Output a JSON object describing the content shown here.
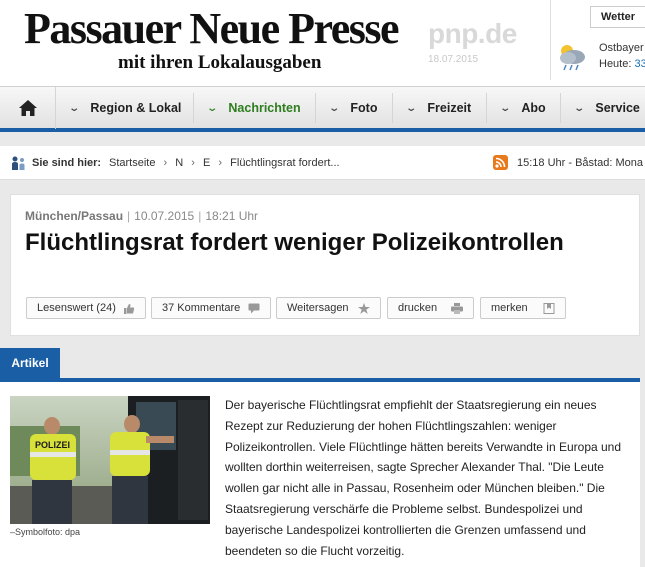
{
  "masthead": {
    "title": "Passauer Neue Presse",
    "subtitle": "mit ihren Lokalausgaben",
    "domain": "pnp.de",
    "date": "18.07.2015",
    "weather_tab": "Wetter",
    "weather_region": "Ostbayer",
    "weather_today_label": "Heute:",
    "weather_today_temp": "33",
    "weather_icon": "cloud-rain-icon"
  },
  "nav": {
    "home_icon": "home-icon",
    "items": [
      {
        "label": "Region & Lokal"
      },
      {
        "label": "Nachrichten"
      },
      {
        "label": "Foto"
      },
      {
        "label": "Freizeit"
      },
      {
        "label": "Abo"
      },
      {
        "label": "Service"
      }
    ],
    "active_color": "#2e7d1e",
    "accent": "#1a5fa6"
  },
  "breadcrumb": {
    "label": "Sie sind hier:",
    "items": [
      "Startseite",
      "N",
      "E",
      "Flüchtlingsrat fordert..."
    ],
    "separator": "›",
    "ticker": "15:18 Uhr - Båstad: Mona"
  },
  "article": {
    "section": "München/Passau",
    "date": "10.07.2015",
    "time": "18:21 Uhr",
    "headline": "Flüchtlingsrat fordert weniger Polizeikontrollen",
    "actions": [
      {
        "label": "Lesenswert (24)",
        "icon": "thumbs-up-icon"
      },
      {
        "label": "37 Kommentare",
        "icon": "speech-bubble-icon"
      },
      {
        "label": "Weitersagen",
        "icon": "star-icon"
      },
      {
        "label": "drucken",
        "icon": "printer-icon"
      },
      {
        "label": "merken",
        "icon": "bookmark-icon"
      }
    ],
    "tab": "Artikel",
    "photo_caption": "–Symbolfoto: dpa",
    "photo_vest_text": "POLIZEI",
    "body": "Der bayerische Flüchtlingsrat empfiehlt der Staatsregierung ein neues Rezept zur Reduzierung der hohen Flüchtlingszahlen: weniger Polizeikontrollen. Viele Flüchtlinge hätten bereits Verwandte in Europa und wollten dorthin weiterreisen, sagte Sprecher Alexander Thal. \"Die Leute wollen gar nicht alle in Passau, Rosenheim oder München bleiben.\" Die Staatsregierung verschärfe die Probleme selbst. Bundespolizei und bayerische Landespolizei kontrollierten die Grenzen umfassend und beendeten so die Flucht vorzeitig."
  }
}
